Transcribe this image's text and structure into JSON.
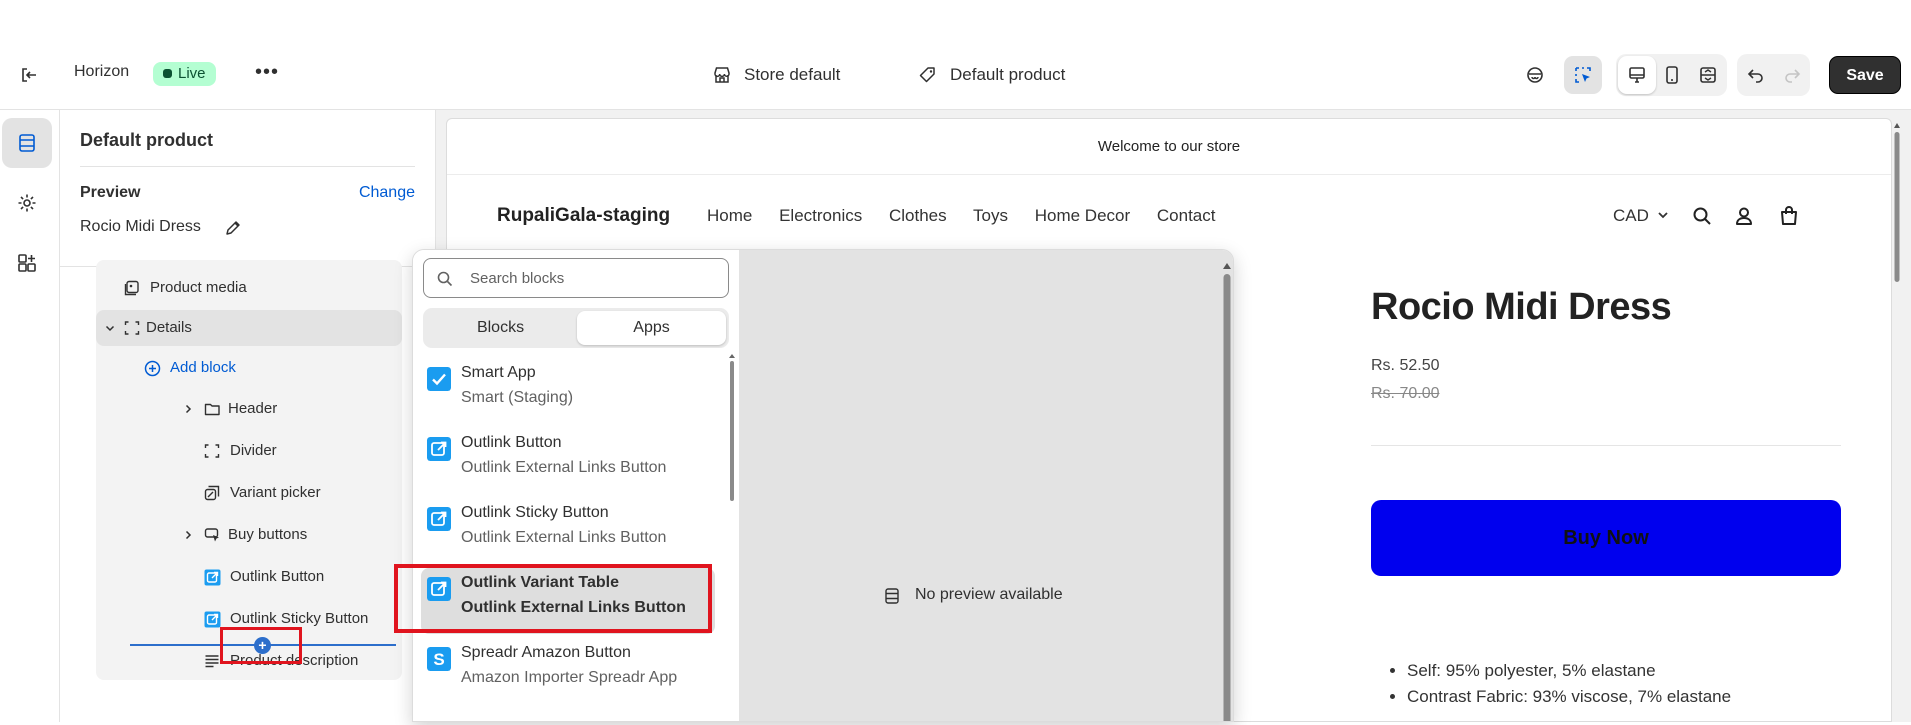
{
  "topbar": {
    "exit_icon": "exit-icon",
    "theme_name": "Horizon",
    "live_badge": "Live",
    "more_icon": "more-horizontal-icon",
    "template_label": "Store default",
    "product_label": "Default product",
    "save_label": "Save",
    "icons": [
      "inspector-icon",
      "select-icon",
      "desktop-icon",
      "mobile-icon",
      "full-width-icon",
      "undo-icon",
      "redo-icon"
    ]
  },
  "rail": {
    "items": [
      "sections-icon",
      "settings-icon",
      "apps-icon"
    ]
  },
  "sidebar": {
    "title": "Default product",
    "preview_label": "Preview",
    "change_label": "Change",
    "preview_product": "Rocio Midi Dress",
    "tree": [
      {
        "label": "Product media",
        "icon": "media-icon"
      },
      {
        "label": "Details",
        "icon": "group-icon"
      },
      {
        "label": "Add block",
        "icon": "plus-circle-icon"
      },
      {
        "label": "Header",
        "icon": "folder-icon"
      },
      {
        "label": "Divider",
        "icon": "divider-icon"
      },
      {
        "label": "Variant picker",
        "icon": "variant-icon"
      },
      {
        "label": "Buy buttons",
        "icon": "buy-buttons-icon"
      },
      {
        "label": "Outlink Button",
        "icon": "app-block-icon"
      },
      {
        "label": "Outlink Sticky Button",
        "icon": "app-block-icon"
      },
      {
        "label": "Product description",
        "icon": "text-icon"
      }
    ]
  },
  "picker": {
    "search_placeholder": "Search blocks",
    "tabs": [
      "Blocks",
      "Apps"
    ],
    "selected_tab": "Apps",
    "apps": [
      {
        "name": "Smart App",
        "desc": "Smart (Staging)",
        "icon": "checkbox-app-icon"
      },
      {
        "name": "Outlink Button",
        "desc": "Outlink External Links Button",
        "icon": "outlink-icon"
      },
      {
        "name": "Outlink Sticky Button",
        "desc": "Outlink External Links Button",
        "icon": "outlink-icon"
      },
      {
        "name": "Outlink Variant Table",
        "desc": "Outlink External Links Button",
        "icon": "outlink-icon"
      },
      {
        "name": "Spreadr Amazon Button",
        "desc": "Amazon Importer Spreadr App",
        "icon": "spreadr-icon"
      }
    ],
    "no_preview": "No preview available"
  },
  "store": {
    "announcement": "Welcome to our store",
    "brand": "RupaliGala-staging",
    "nav": [
      "Home",
      "Electronics",
      "Clothes",
      "Toys",
      "Home Decor",
      "Contact"
    ],
    "currency": "CAD",
    "product_title": "Rocio Midi Dress",
    "price": "Rs. 52.50",
    "compare_price": "Rs. 70.00",
    "buy_now": "Buy Now",
    "bullets": [
      "Self: 95% polyester, 5% elastane",
      "Contrast Fabric: 93% viscose, 7% elastane"
    ]
  },
  "colors": {
    "accent": "#005bd3",
    "buy_button": "#0000ee",
    "live_badge_bg": "#b4fed2",
    "highlight_red": "#e0141e",
    "app_icon_blue": "#1a9cf0"
  }
}
